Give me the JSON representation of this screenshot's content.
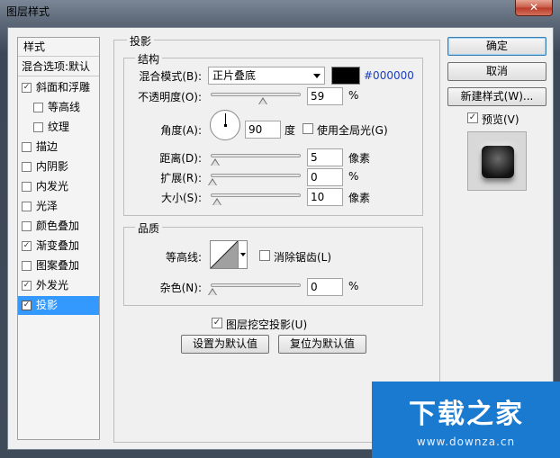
{
  "window": {
    "title": "图层样式",
    "close_label": "✕"
  },
  "sidebar": {
    "header": "样式",
    "blend_default": "混合选项:默认",
    "items": [
      {
        "label": "斜面和浮雕",
        "checked": "✓"
      },
      {
        "label": "等高线",
        "checked": ""
      },
      {
        "label": "纹理",
        "checked": ""
      },
      {
        "label": "描边",
        "checked": ""
      },
      {
        "label": "内阴影",
        "checked": ""
      },
      {
        "label": "内发光",
        "checked": ""
      },
      {
        "label": "光泽",
        "checked": ""
      },
      {
        "label": "颜色叠加",
        "checked": ""
      },
      {
        "label": "渐变叠加",
        "checked": "✓"
      },
      {
        "label": "图案叠加",
        "checked": ""
      },
      {
        "label": "外发光",
        "checked": "✓"
      },
      {
        "label": "投影",
        "checked": "✓"
      }
    ]
  },
  "panel": {
    "title": "投影",
    "structure": {
      "legend": "结构",
      "blend_mode_label": "混合模式(B):",
      "blend_mode_value": "正片叠底",
      "color_hex": "#000000",
      "opacity_label": "不透明度(O):",
      "opacity_value": "59",
      "percent": "%",
      "angle_label": "角度(A):",
      "angle_value": "90",
      "degree": "度",
      "global_light_label": "使用全局光(G)",
      "distance_label": "距离(D):",
      "distance_value": "5",
      "pixels": "像素",
      "spread_label": "扩展(R):",
      "spread_value": "0",
      "size_label": "大小(S):",
      "size_value": "10"
    },
    "quality": {
      "legend": "品质",
      "contour_label": "等高线:",
      "antialias_label": "消除锯齿(L)",
      "noise_label": "杂色(N):",
      "noise_value": "0",
      "percent": "%"
    },
    "knockout_label": "图层挖空投影(U)",
    "knockout_checked": "✓",
    "set_default": "设置为默认值",
    "reset_default": "复位为默认值"
  },
  "buttons": {
    "ok": "确定",
    "cancel": "取消",
    "new_style": "新建样式(W)...",
    "preview_label": "预览(V)",
    "preview_checked": "✓"
  },
  "watermark": {
    "title": "下载之家",
    "url": "www.downza.cn"
  }
}
